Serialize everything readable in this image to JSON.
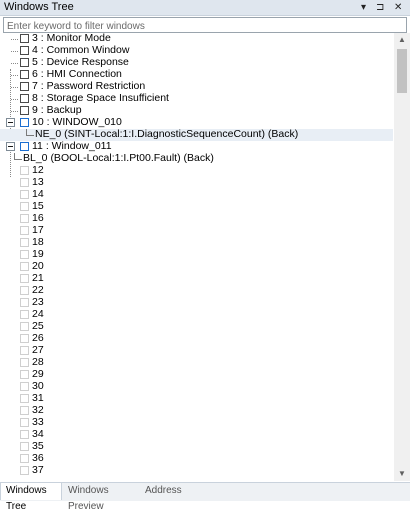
{
  "panel": {
    "title": "Windows Tree",
    "dropdown_icon": "▾",
    "pin_icon": "⊐",
    "close_icon": "✕"
  },
  "filter": {
    "placeholder": "Enter keyword to filter windows",
    "value": ""
  },
  "tree": {
    "rows": [
      {
        "label": "3 : Monitor Mode"
      },
      {
        "label": "4 : Common Window"
      },
      {
        "label": "5 : Device Response"
      },
      {
        "label": "6 : HMI Connection"
      },
      {
        "label": "7 : Password Restriction"
      },
      {
        "label": "8 : Storage Space Insufficient"
      },
      {
        "label": "9 : Backup"
      },
      {
        "label": "10 : WINDOW_010"
      },
      {
        "label": "NE_0 (SINT-Local:1:I.DiagnosticSequenceCount) (Back)"
      },
      {
        "label": "11 : Window_011"
      },
      {
        "label": "BL_0 (BOOL-Local:1:I.Pt00.Fault) (Back)"
      },
      {
        "label": "12"
      },
      {
        "label": "13"
      },
      {
        "label": "14"
      },
      {
        "label": "15"
      },
      {
        "label": "16"
      },
      {
        "label": "17"
      },
      {
        "label": "18"
      },
      {
        "label": "19"
      },
      {
        "label": "20"
      },
      {
        "label": "21"
      },
      {
        "label": "22"
      },
      {
        "label": "23"
      },
      {
        "label": "24"
      },
      {
        "label": "25"
      },
      {
        "label": "26"
      },
      {
        "label": "27"
      },
      {
        "label": "28"
      },
      {
        "label": "29"
      },
      {
        "label": "30"
      },
      {
        "label": "31"
      },
      {
        "label": "32"
      },
      {
        "label": "33"
      },
      {
        "label": "34"
      },
      {
        "label": "35"
      },
      {
        "label": "36"
      },
      {
        "label": "37"
      }
    ]
  },
  "tabs": [
    {
      "label": "Windows Tree",
      "active": true
    },
    {
      "label": "Windows Preview",
      "active": false
    },
    {
      "label": "Address",
      "active": false
    }
  ]
}
